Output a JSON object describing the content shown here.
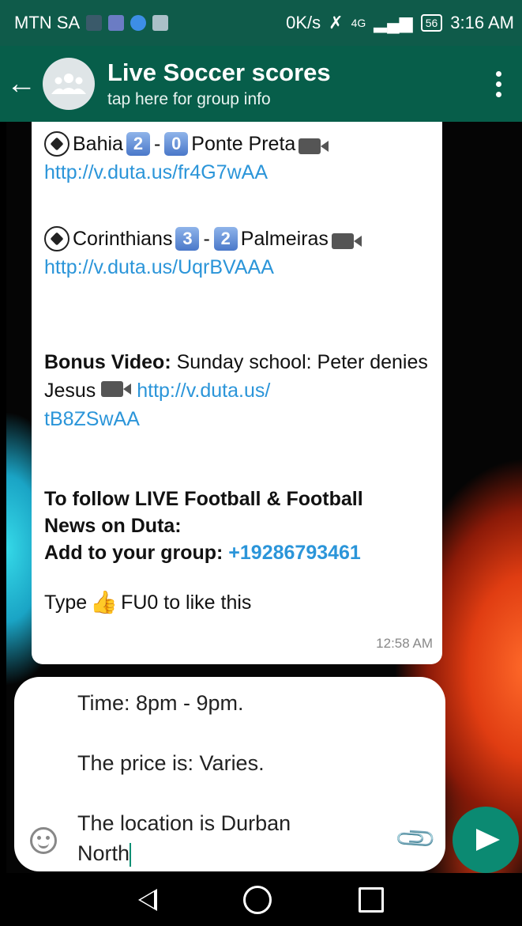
{
  "statusbar": {
    "carrier": "MTN SA",
    "speed": "0K/s",
    "network": "4G",
    "battery": "56",
    "time": "3:16 AM"
  },
  "header": {
    "title": "Live Soccer scores",
    "subtitle": "tap here for group info"
  },
  "message": {
    "match1": {
      "home": "Bahia",
      "home_score": "2",
      "away_score": "0",
      "away": "Ponte Preta",
      "link": "http://v.duta.us/fr4G7wAA"
    },
    "match2": {
      "home": "Corinthians",
      "home_score": "3",
      "away_score": "2",
      "away": "Palmeiras",
      "link": "http://v.duta.us/UqrBVAAA"
    },
    "bonus_label": "Bonus Video:",
    "bonus_text": "Sunday school: Peter denies Jesus",
    "bonus_link_1": "http://v.duta.us/",
    "bonus_link_2": "tB8ZSwAA",
    "follow_line1": "To follow LIVE Football & Football",
    "follow_line2": "News on Duta:",
    "follow_line3": "Add to your group:",
    "phone": "+19286793461",
    "like_pre": "Type",
    "like_post": "FU0 to like this",
    "timestamp": "12:58 AM"
  },
  "compose": {
    "line1": "Time: 8pm - 9pm.",
    "line2": "The price is: Varies.",
    "line3a": "The location is Durban",
    "line3b": "North"
  },
  "colors": {
    "header_bg": "#075e4a",
    "link": "#2b95d9",
    "send": "#0b8a72"
  }
}
